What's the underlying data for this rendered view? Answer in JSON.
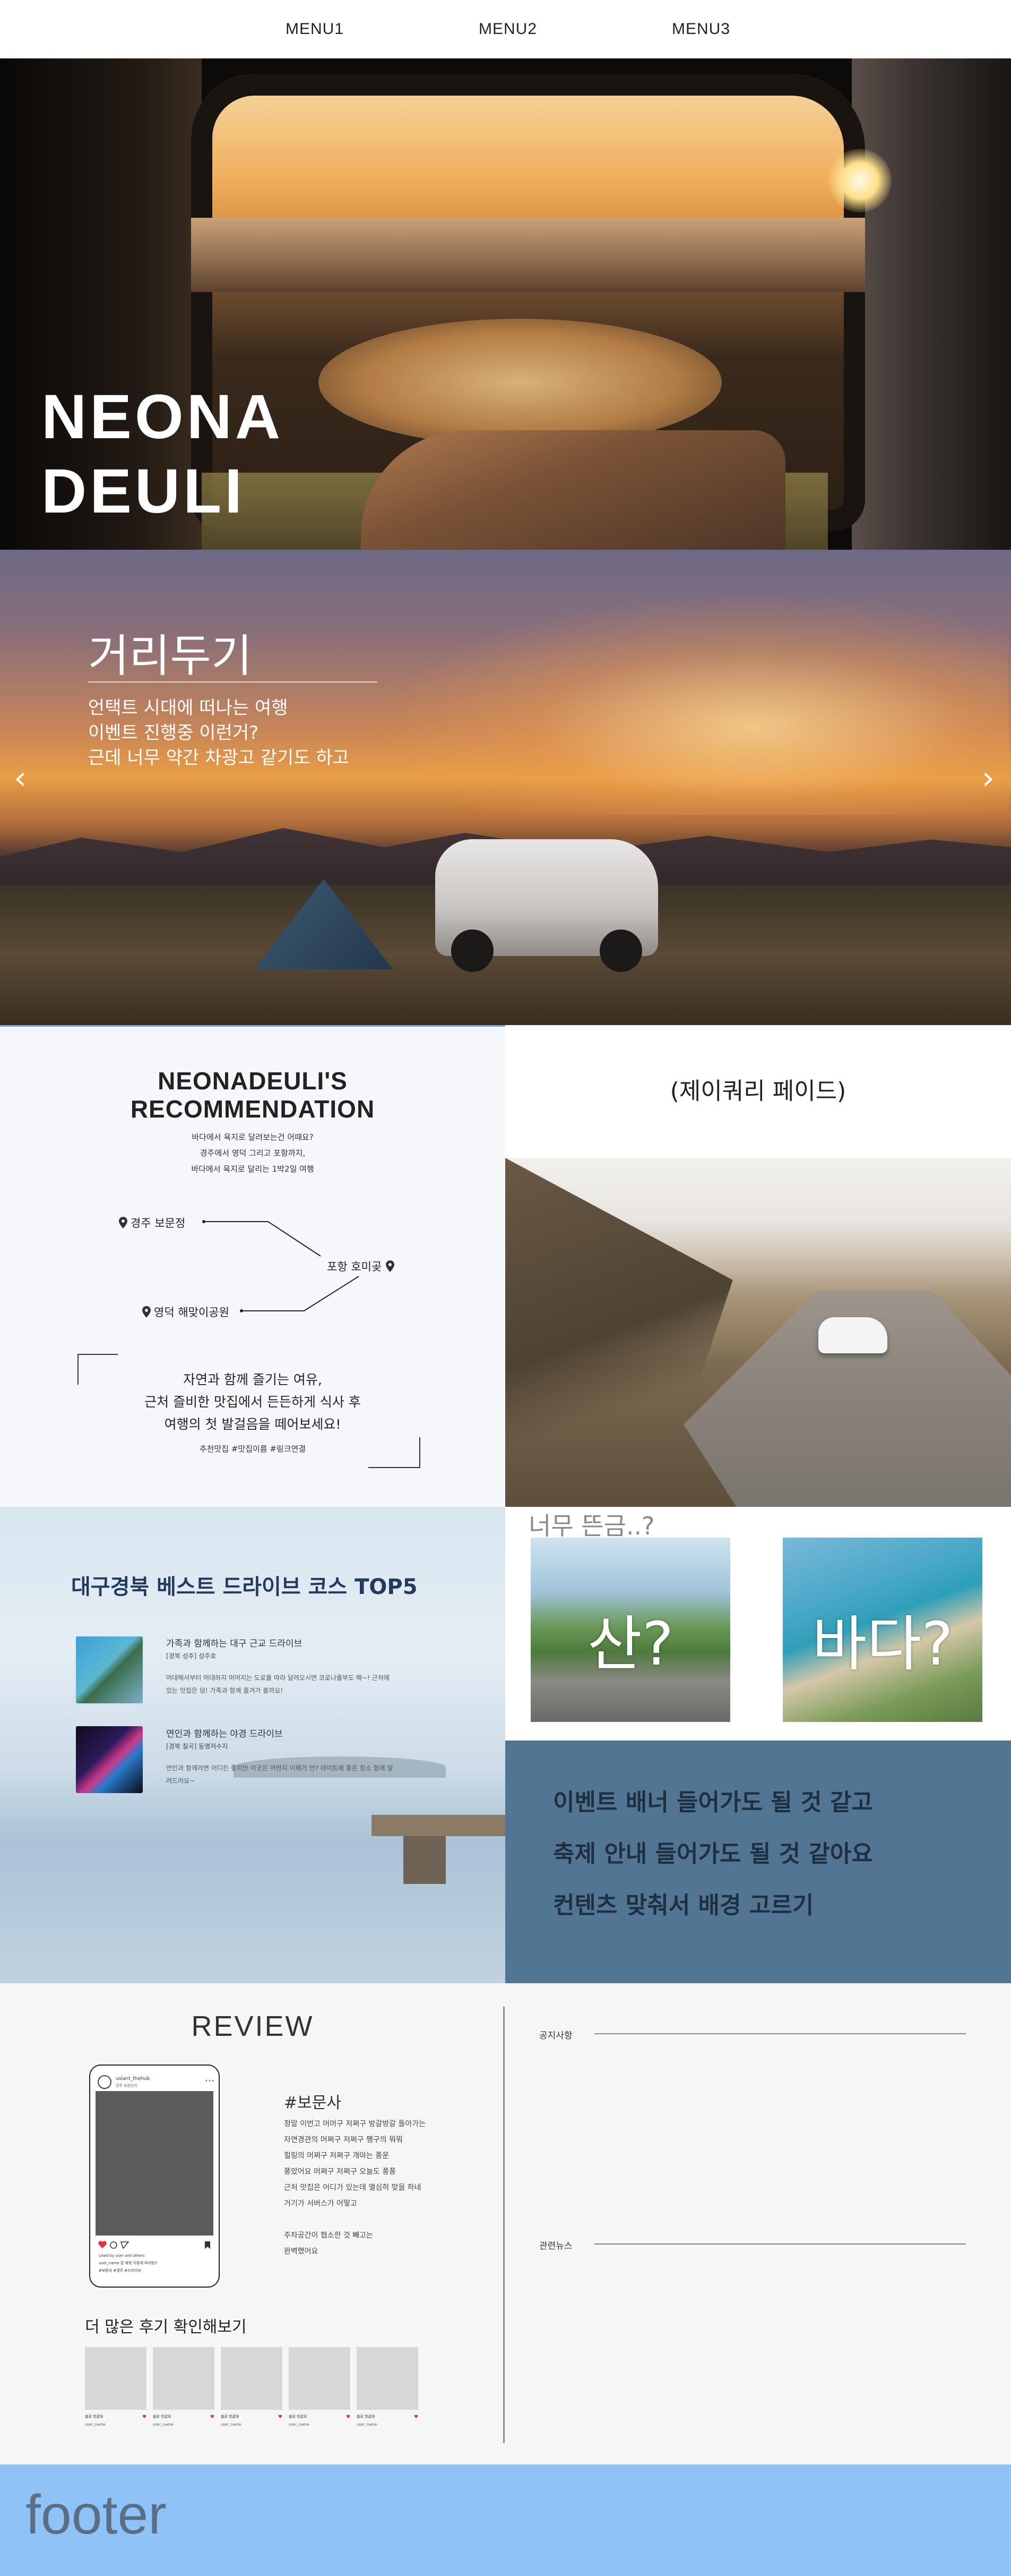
{
  "nav": {
    "items": [
      "MENU1",
      "MENU2",
      "MENU3"
    ]
  },
  "hero": {
    "title": "NEONA\nDEULI"
  },
  "camp_banner": {
    "title": "거리두기",
    "lines": [
      "언택트 시대에 떠나는 여행",
      "이벤트 진행중 이런거?",
      "근데 너무 약간 차광고 같기도 하고"
    ],
    "prev_arrow": "‹",
    "next_arrow": "›"
  },
  "recommendation": {
    "title_line1": "NEONADEULI'S",
    "title_line2": "RECOMMENDATION",
    "sub_lines": [
      "바다에서 육지로 달려보는건 어때요?",
      "경주에서 영덕 그리고 포항까지,",
      "바다에서 육지로 달리는 1박2일 여행"
    ],
    "pins": [
      "경주 보문정",
      "포항 호미곶",
      "영덕 해맞이공원"
    ],
    "body_lines": [
      "자연과 함께 즐기는 여유,",
      "근처 즐비한 맛집에서 든든하게 식사 후",
      "여행의 첫 발걸음을 떼어보세요!"
    ],
    "tags": "추천맛집 #맛집이름 #링크연결"
  },
  "jeju": {
    "title": "(제이쿼리 페이드)"
  },
  "top5": {
    "title": "대구경북 베스트 드라이브 코스 TOP5",
    "courses": [
      {
        "title": "가족과 함께하는 대구 근교 드라이브",
        "sub": "[경북 성주] 성주호",
        "desc": "머대해서부터 머대하지 머머지는 도로를 따라 달려오시면 코로나를부도 해~! 근처에 있는 맛집은 덤! 가족과 함께 즐겨가 볼까요!"
      },
      {
        "title": "연인과 함께하는 야경 드라이브",
        "sub": "[경북 칠곡] 동명저수지",
        "desc": "연인과 함께라면 어디든 좋지만 이곳은 어떤지 이해가 안? 데이트에 좋은 장소 함께 알려드려요~"
      }
    ]
  },
  "choice": {
    "question": "너무 뜬금..?",
    "mountain": "산?",
    "sea": "바다?"
  },
  "event": {
    "lines": [
      "이벤트 배너 들어가도 될 것 같고",
      "축제 안내 들어가도 될 것 같아요",
      "컨텐츠 맞춰서 배경 고르기"
    ]
  },
  "review": {
    "title": "REVIEW",
    "phone": {
      "name": "uslant_thehub",
      "location": "경주 보문단지",
      "caption": [
        "Liked by user and others",
        "user_name 흰 제목 이렇게 파이팅!!",
        "#보문사 #경주 #드라이브"
      ]
    },
    "tag": "#보문사",
    "text_lines": [
      "정말 이번고 머머구 저쩌구 방갈방갈 돌아가는",
      "자연경관의 머쩌구 저쩌구 쨍구의 뭐뭐",
      "힐링의 머쩌구 저쩌구 개마는 풍운",
      "풍았어요 머쩌구 저쩌구 오늘도 풍풍",
      "근처 맛집은 어디가 있는데 앨심히 맞을 하네",
      "거기가 서버스가 어떻고",
      "",
      "주차공간이 협소한 것 빼고는",
      "완벽했어요"
    ],
    "more_title": "더 많은 후기 확인해보기",
    "cards": [
      {
        "name": "블로 방갈와",
        "user": "user_name"
      },
      {
        "name": "블로 방갈와",
        "user": "user_name"
      },
      {
        "name": "블로 방갈와",
        "user": "user_name"
      },
      {
        "name": "블로 방갈와",
        "user": "user_name"
      },
      {
        "name": "블로 방갈와",
        "user": "user_name"
      }
    ]
  },
  "news": {
    "notice_label": "공지사항",
    "related_label": "관련뉴스"
  },
  "footer": {
    "text": "footer"
  }
}
